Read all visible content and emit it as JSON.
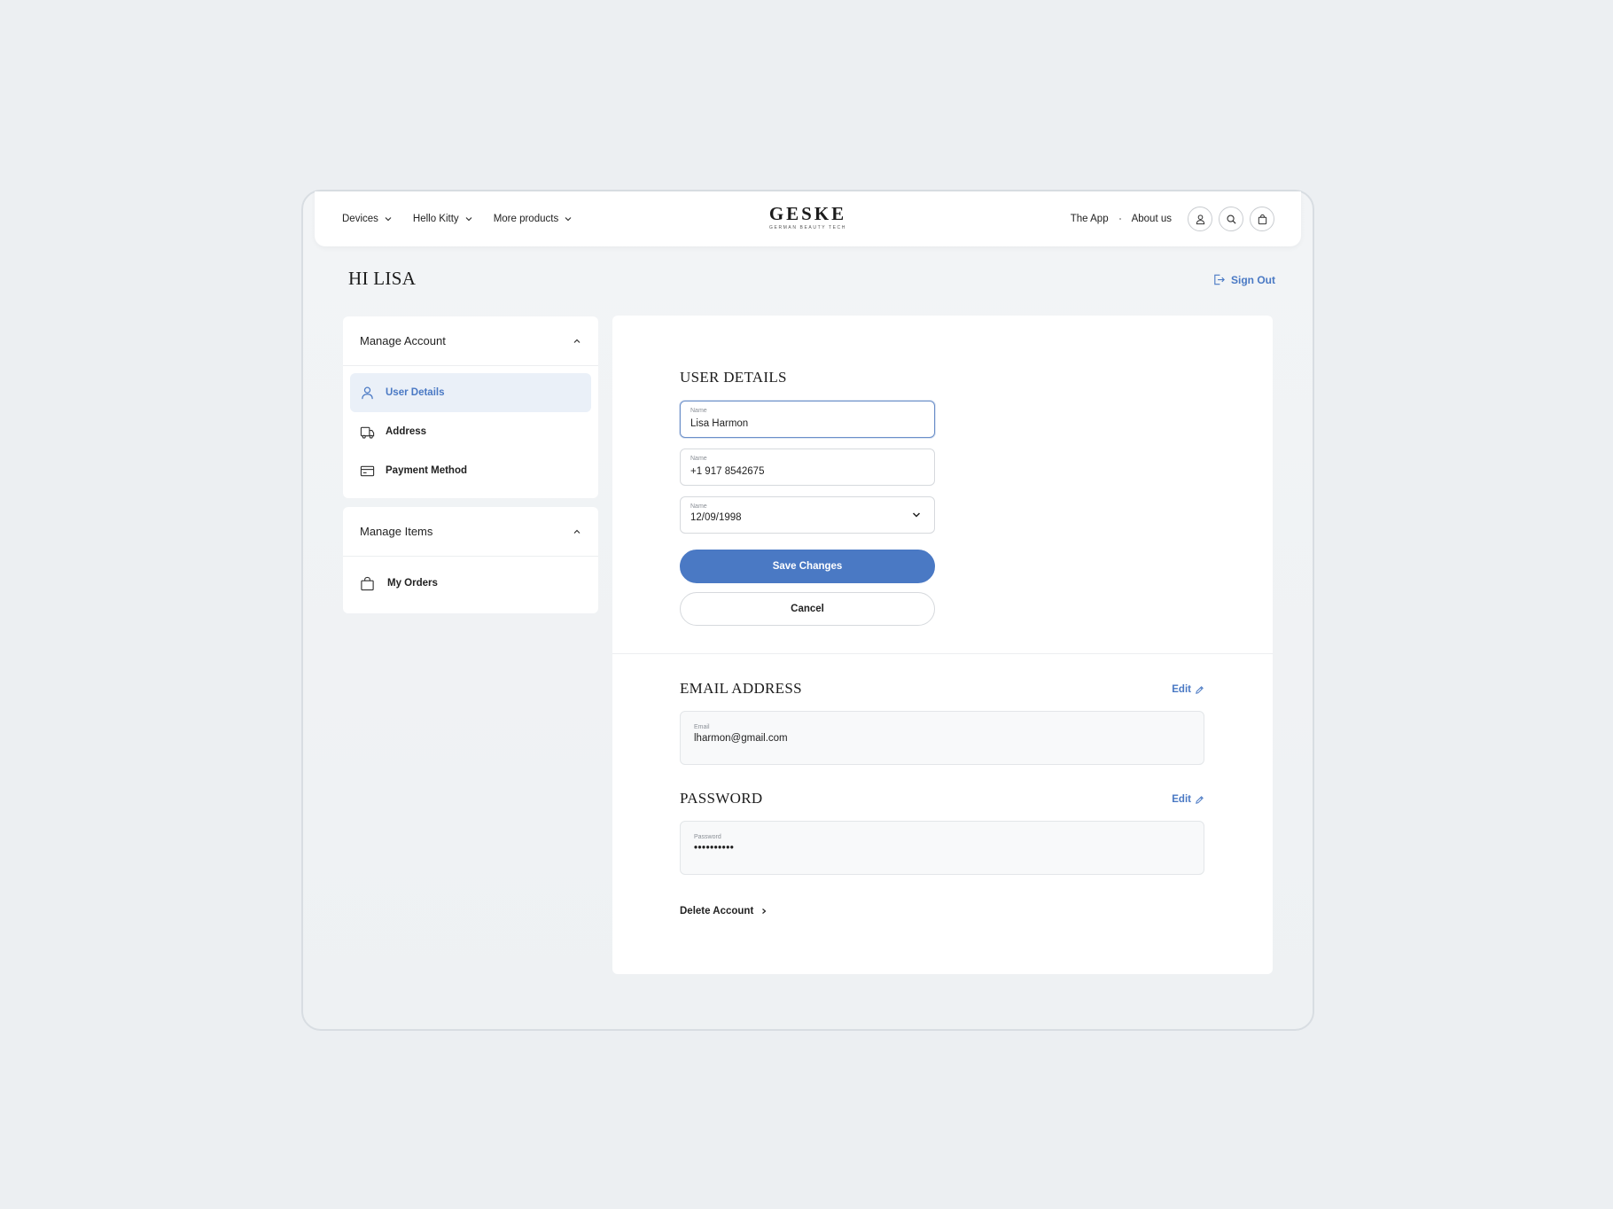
{
  "nav": {
    "menus": [
      "Devices",
      "Hello Kitty",
      "More products"
    ],
    "logo_main": "GESKE",
    "logo_sub": "GERMAN BEAUTY TECH",
    "links": [
      "The App",
      "About us"
    ],
    "icons": [
      "user-icon",
      "search-icon",
      "bag-icon"
    ]
  },
  "greeting": "HI LISA",
  "signout_label": "Sign Out",
  "sidebar": {
    "account": {
      "title": "Manage Account",
      "items": [
        {
          "label": "User Details",
          "icon": "user-icon",
          "active": true
        },
        {
          "label": "Address",
          "icon": "truck-icon",
          "active": false
        },
        {
          "label": "Payment Method",
          "icon": "card-icon",
          "active": false
        }
      ]
    },
    "items_section": {
      "title": "Manage Items",
      "items": [
        {
          "label": "My Orders",
          "icon": "bag-icon"
        }
      ]
    }
  },
  "user_details": {
    "title": "USER DETAILS",
    "name": {
      "label": "Name",
      "value": "Lisa Harmon"
    },
    "phone": {
      "label": "Name",
      "value": "+1 917 8542675"
    },
    "birthdate": {
      "label": "Name",
      "value": "12/09/1998"
    },
    "save_label": "Save Changes",
    "cancel_label": "Cancel"
  },
  "email_section": {
    "title": "EMAIL ADDRESS",
    "edit_label": "Edit",
    "field_label": "Email",
    "value": "lharmon@gmail.com"
  },
  "password_section": {
    "title": "PASSWORD",
    "edit_label": "Edit",
    "field_label": "Password",
    "value": "••••••••••"
  },
  "delete_label": "Delete Account",
  "colors": {
    "accent": "#4a79c4",
    "background": "#eceff2",
    "active_bg": "#eaf0f8"
  }
}
